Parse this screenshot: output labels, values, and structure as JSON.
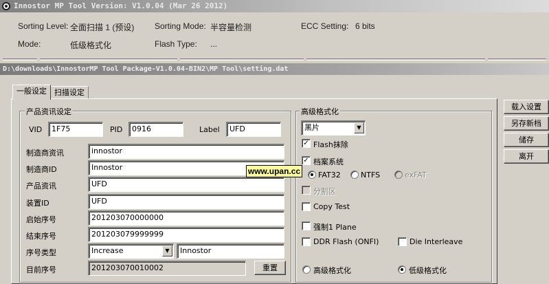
{
  "main_window": {
    "title": "Innostor MP Tool Version: V1.0.04 (Mar 26 2012)"
  },
  "info": {
    "sorting_level_label": "Sorting Level:",
    "sorting_level_value": "全面扫描 1 (预设)",
    "sorting_mode_label": "Sorting Mode:",
    "sorting_mode_value": "半容量检测",
    "ecc_label": "ECC Setting:",
    "ecc_value": "6 bits",
    "mode_label": "Mode:",
    "mode_value": "低级格式化",
    "flash_type_label": "Flash Type:",
    "flash_type_value": "..."
  },
  "setting_dialog": {
    "title": "D:\\downloads\\InnostorMP Tool Package-V1.0.04-BIN2\\MP Tool\\setting.dat",
    "tabs": [
      {
        "label": "一般设定",
        "active": true
      },
      {
        "label": "扫描设定",
        "active": false
      }
    ],
    "product_group": {
      "title": "产品资讯设定",
      "vid_label": "VID",
      "vid_value": "1F75",
      "pid_label": "PID",
      "pid_value": "0916",
      "label_label": "Label",
      "label_value": "UFD",
      "vendor_info_label": "制造商资讯",
      "vendor_info_value": "innostor",
      "vendor_id_label": "制造商ID",
      "vendor_id_value": "Innostor",
      "product_info_label": "产品资讯",
      "product_info_value": "UFD",
      "device_id_label": "装置ID",
      "device_id_value": "UFD",
      "start_serial_label": "启始序号",
      "start_serial_value": "201203070000000",
      "end_serial_label": "结束序号",
      "end_serial_value": "201203079999999",
      "serial_type_label": "序号类型",
      "serial_type_value": "Increase",
      "serial_prefix_value": "Innostor",
      "current_serial_label": "目前序号",
      "current_serial_value": "201203070010002",
      "reset_button": "重置"
    },
    "advanced_group": {
      "title": "高级格式化",
      "color_select_value": "黑片",
      "flash_erase_label": "Flash抹除",
      "flash_erase_checked": true,
      "filesystem_label": "档案系统",
      "filesystem_checked": true,
      "fs_options": [
        "FAT32",
        "NTFS",
        "exFAT"
      ],
      "fs_selected": "FAT32",
      "partition_label": "分割区",
      "copy_test_label": "Copy Test",
      "force_plane_label": "强制1 Plane",
      "ddr_flash_label": "DDR Flash (ONFI)",
      "die_interleave_label": "Die Interleave",
      "format_high_label": "高级格式化",
      "format_low_label": "低级格式化",
      "format_selected": "低级格式化"
    },
    "side_buttons": [
      "载入设置",
      "另存新档",
      "储存",
      "离开"
    ]
  },
  "watermark": "www.upan.cc"
}
